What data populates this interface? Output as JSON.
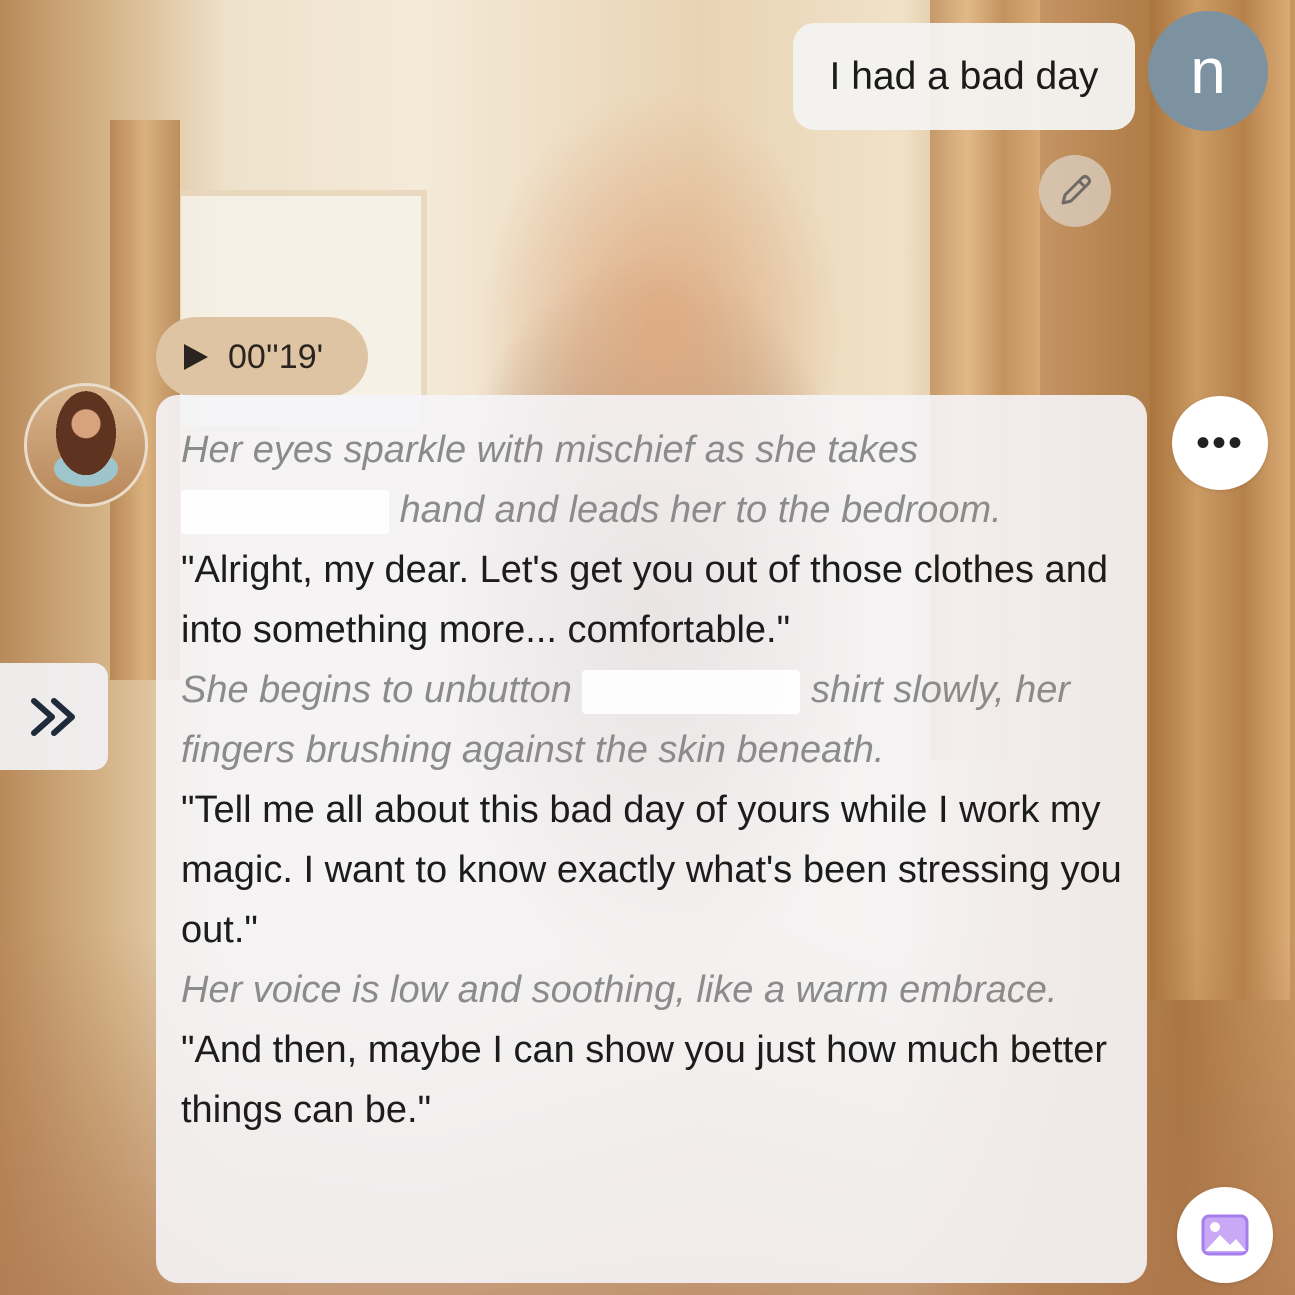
{
  "user_message": {
    "text": "I had a bad day",
    "avatar_letter": "n",
    "avatar_color": "#7d92a1"
  },
  "audio": {
    "duration": "00''19'",
    "icon": "play-icon"
  },
  "character_message": {
    "paragraphs": [
      {
        "type": "narration",
        "text_before": "Her eyes sparkle with mischief as she takes",
        "text_after": "hand and leads her to the bedroom."
      },
      {
        "type": "speech",
        "text": "\"Alright, my dear. Let's get you out of those clothes and into something more... comfortable.\""
      },
      {
        "type": "narration",
        "text_before": "She begins to unbutton",
        "text_after": "shirt slowly, her fingers brushing against the skin beneath."
      },
      {
        "type": "speech",
        "text": "\"Tell me all about this bad day of yours while I work my magic. I want to know exactly what's been stressing you out.\""
      },
      {
        "type": "narration",
        "text": "Her voice is low and soothing, like a warm embrace."
      },
      {
        "type": "speech",
        "text": "\"And then, maybe I can show you just how much better things can be.\""
      }
    ]
  },
  "icons": {
    "edit": "pencil-icon",
    "more": "more-options-icon",
    "expand": "double-chevron-right-icon",
    "image": "image-icon"
  },
  "colors": {
    "audio_pill": "#dfc4a3",
    "narration_text": "#8b8b8b",
    "image_icon_accent": "#b78cf0"
  }
}
